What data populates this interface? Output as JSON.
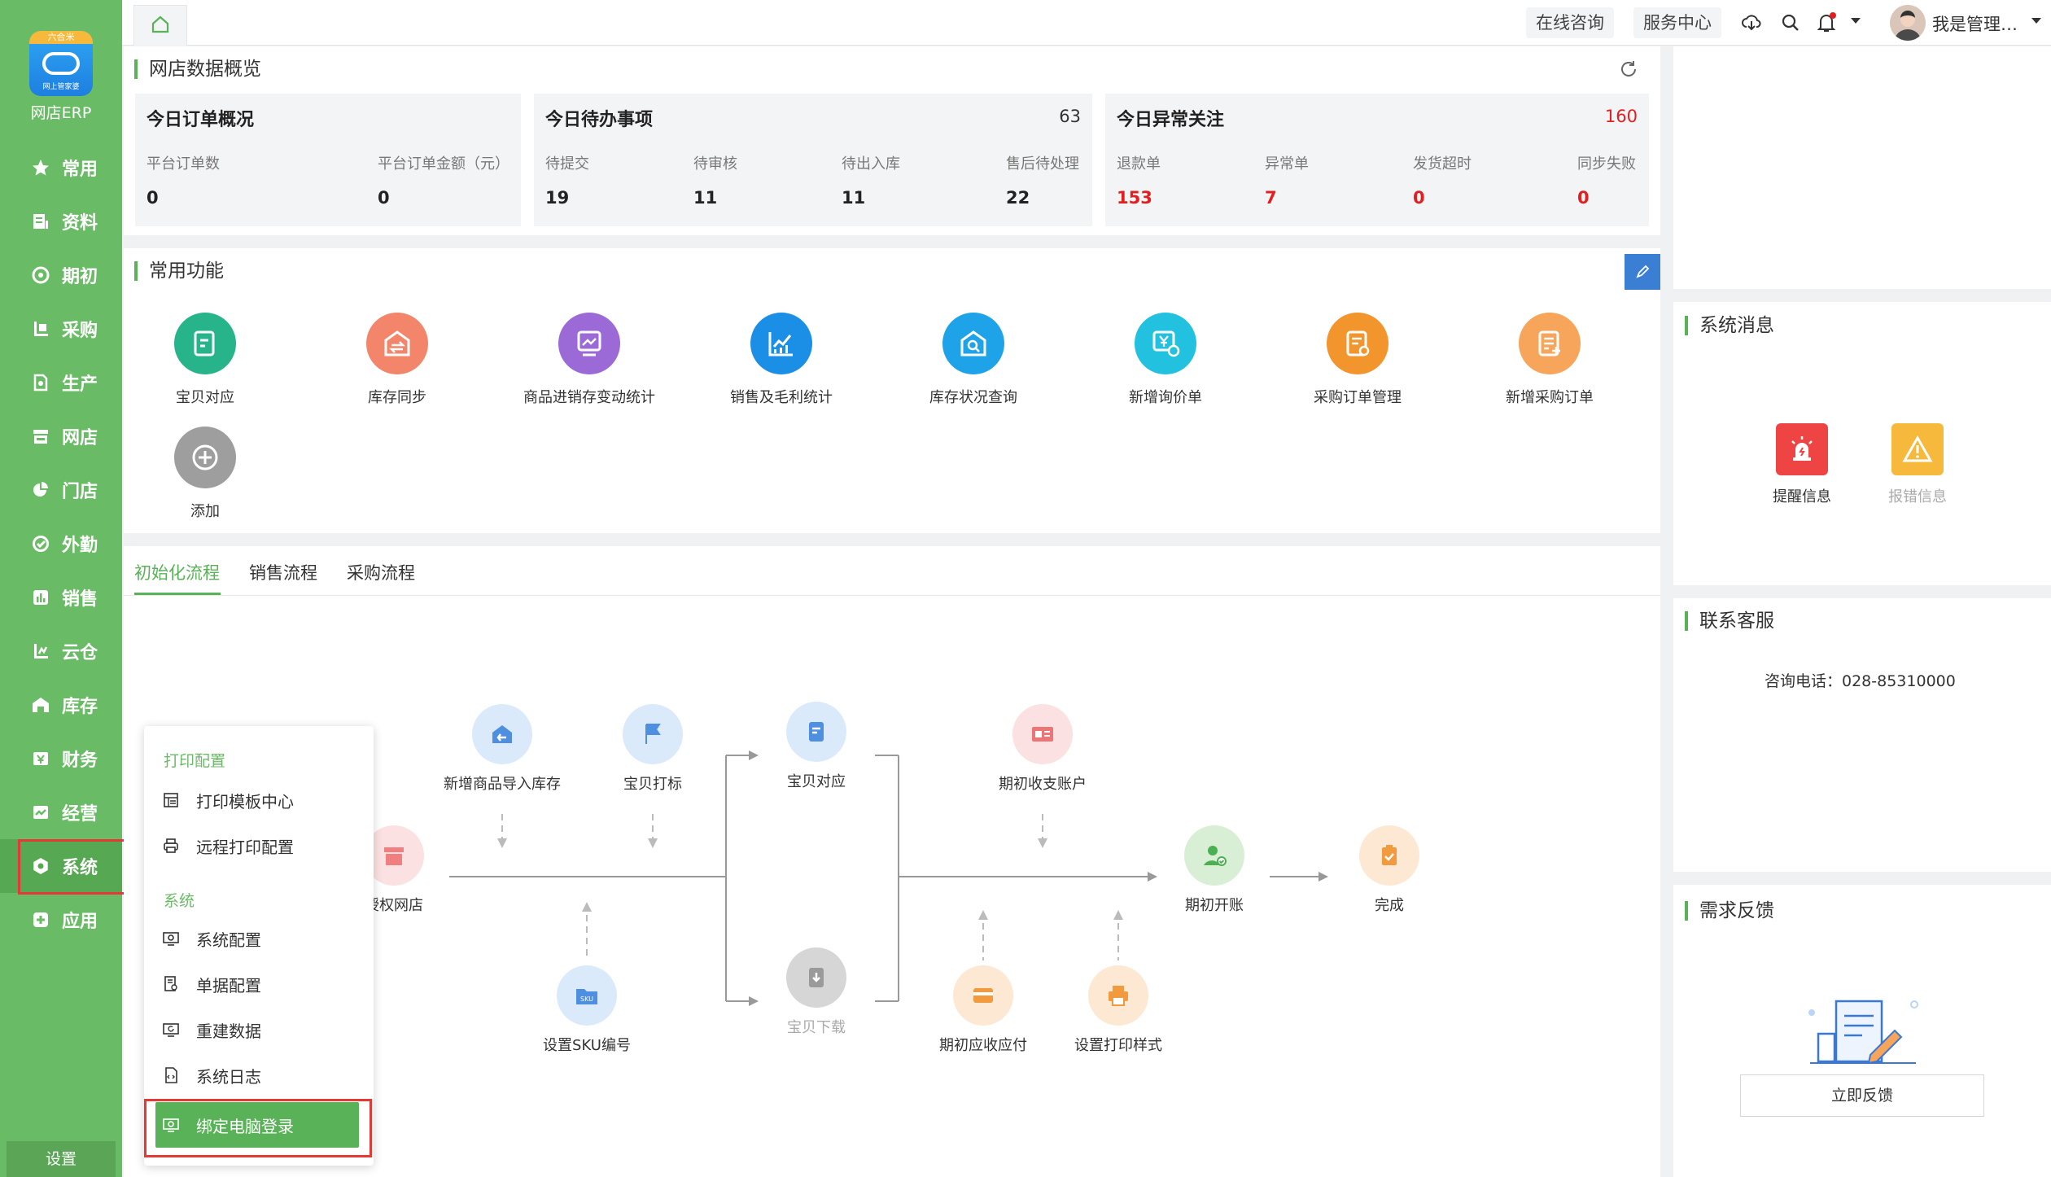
{
  "sidebar": {
    "logo_ribbon": "六合米",
    "logo_caption": "网上管家婆",
    "app_name": "网店ERP",
    "items": [
      {
        "label": "常用",
        "icon": "star-icon"
      },
      {
        "label": "资料",
        "icon": "document-icon"
      },
      {
        "label": "期初",
        "icon": "target-icon"
      },
      {
        "label": "采购",
        "icon": "purchase-icon"
      },
      {
        "label": "生产",
        "icon": "production-icon"
      },
      {
        "label": "网店",
        "icon": "shop-icon"
      },
      {
        "label": "门店",
        "icon": "pie-icon"
      },
      {
        "label": "外勤",
        "icon": "field-icon"
      },
      {
        "label": "销售",
        "icon": "sales-chart-icon"
      },
      {
        "label": "云仓",
        "icon": "cloud-warehouse-icon"
      },
      {
        "label": "库存",
        "icon": "warehouse-icon"
      },
      {
        "label": "财务",
        "icon": "finance-icon"
      },
      {
        "label": "经营",
        "icon": "business-icon"
      },
      {
        "label": "系统",
        "icon": "gear-icon"
      },
      {
        "label": "应用",
        "icon": "plus-box-icon"
      }
    ],
    "settings_label": "设置"
  },
  "topbar": {
    "online_consult": "在线咨询",
    "service_center": "服务中心",
    "user_name": "我是管理…"
  },
  "overview": {
    "title": "网店数据概览",
    "cards": [
      {
        "title": "今日订单概况",
        "count": "",
        "stats": [
          {
            "label": "平台订单数",
            "value": "0"
          },
          {
            "label": "平台订单金额（元）",
            "value": "0"
          }
        ]
      },
      {
        "title": "今日待办事项",
        "count": "63",
        "stats": [
          {
            "label": "待提交",
            "value": "19"
          },
          {
            "label": "待审核",
            "value": "11"
          },
          {
            "label": "待出入库",
            "value": "11"
          },
          {
            "label": "售后待处理",
            "value": "22"
          }
        ]
      },
      {
        "title": "今日异常关注",
        "count": "160",
        "stats": [
          {
            "label": "退款单",
            "value": "153"
          },
          {
            "label": "异常单",
            "value": "7"
          },
          {
            "label": "发货超时",
            "value": "0"
          },
          {
            "label": "同步失败",
            "value": "0"
          }
        ]
      }
    ]
  },
  "functions": {
    "title": "常用功能",
    "items": [
      {
        "label": "宝贝对应",
        "color": "#27b48a"
      },
      {
        "label": "库存同步",
        "color": "#f3866a"
      },
      {
        "label": "商品进销存变动统计",
        "color": "#9b6ad6"
      },
      {
        "label": "销售及毛利统计",
        "color": "#1b8ee6"
      },
      {
        "label": "库存状况查询",
        "color": "#1fa3e8"
      },
      {
        "label": "新增询价单",
        "color": "#22c1e0"
      },
      {
        "label": "采购订单管理",
        "color": "#f2952d"
      },
      {
        "label": "新增采购订单",
        "color": "#f6a55a"
      },
      {
        "label": "添加",
        "color": "#9e9e9e"
      }
    ]
  },
  "flow": {
    "tabs": [
      "初始化流程",
      "销售流程",
      "采购流程"
    ],
    "nodes": {
      "auth_shop": "授权网店",
      "import_goods": "新增商品导入库存",
      "mark_goods": "宝贝打标",
      "sku_code": "设置SKU编号",
      "match_goods": "宝贝对应",
      "download_goods": "宝贝下载",
      "init_account": "期初收支账户",
      "init_receivable": "期初应收应付",
      "print_style": "设置打印样式",
      "init_open": "期初开账",
      "done": "完成"
    }
  },
  "popup_menu": {
    "group_print": "打印配置",
    "print_template": "打印模板中心",
    "remote_print": "远程打印配置",
    "group_system": "系统",
    "system_config": "系统配置",
    "doc_config": "单据配置",
    "rebuild_data": "重建数据",
    "system_log": "系统日志",
    "bind_pc": "绑定电脑登录"
  },
  "right": {
    "messages_title": "系统消息",
    "alert_info": "提醒信息",
    "error_info": "报错信息",
    "service_title": "联系客服",
    "phone": "咨询电话：028-85310000",
    "feedback_title": "需求反馈",
    "feedback_button": "立即反馈"
  }
}
